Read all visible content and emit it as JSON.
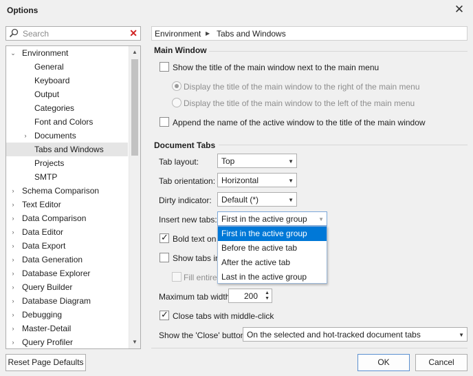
{
  "window": {
    "title": "Options"
  },
  "search": {
    "placeholder": "Search"
  },
  "tree": {
    "items": [
      {
        "label": "Environment"
      },
      {
        "label": "General"
      },
      {
        "label": "Keyboard"
      },
      {
        "label": "Output"
      },
      {
        "label": "Categories"
      },
      {
        "label": "Font and Colors"
      },
      {
        "label": "Documents"
      },
      {
        "label": "Tabs and Windows"
      },
      {
        "label": "Projects"
      },
      {
        "label": "SMTP"
      },
      {
        "label": "Schema Comparison"
      },
      {
        "label": "Text Editor"
      },
      {
        "label": "Data Comparison"
      },
      {
        "label": "Data Editor"
      },
      {
        "label": "Data Export"
      },
      {
        "label": "Data Generation"
      },
      {
        "label": "Database Explorer"
      },
      {
        "label": "Query Builder"
      },
      {
        "label": "Database Diagram"
      },
      {
        "label": "Debugging"
      },
      {
        "label": "Master-Detail"
      },
      {
        "label": "Query Profiler"
      }
    ]
  },
  "breadcrumb": {
    "root": "Environment",
    "current": "Tabs and Windows"
  },
  "main_window": {
    "heading": "Main Window",
    "show_title": "Show the title of the main window next to the main menu",
    "display_right": "Display the title of the main window to the right of the main menu",
    "display_left": "Display the title of the main window to the left of the main menu",
    "append_name": "Append the name of the active window to the title of the main window"
  },
  "document_tabs": {
    "heading": "Document Tabs",
    "tab_layout_label": "Tab layout:",
    "tab_layout_value": "Top",
    "tab_orientation_label": "Tab orientation:",
    "tab_orientation_value": "Horizontal",
    "dirty_indicator_label": "Dirty indicator:",
    "dirty_indicator_value": "Default (*)",
    "insert_new_tabs_label": "Insert new tabs:",
    "insert_new_tabs_value": "First in the active group",
    "insert_options": [
      "First in the active group",
      "Before the active tab",
      "After the active tab",
      "Last in the active group"
    ],
    "bold_text": "Bold text on s",
    "show_tabs": "Show tabs in r",
    "fill_entire": "Fill entire c",
    "max_tab_width_label": "Maximum tab width:",
    "max_tab_width_value": "200",
    "close_middle_click": "Close tabs with middle-click",
    "show_close_label": "Show the 'Close' button:",
    "show_close_value": "On the selected and hot-tracked document tabs"
  },
  "buttons": {
    "reset": "Reset Page Defaults",
    "ok": "OK",
    "cancel": "Cancel"
  }
}
